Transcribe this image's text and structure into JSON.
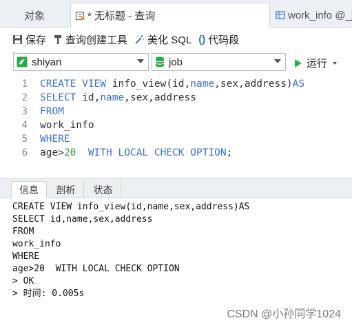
{
  "tabs": {
    "objects": "对象",
    "query": "* 无标题 - 查询",
    "work_info": "work_info @_j"
  },
  "toolbar": {
    "save": "保存",
    "query_builder": "查询创建工具",
    "beautify": "美化 SQL",
    "snippet": "代码段"
  },
  "selectors": {
    "connection": "shiyan",
    "database": "job",
    "run": "运行"
  },
  "editor": {
    "line_numbers": [
      "1",
      "2",
      "3",
      "4",
      "5",
      "6"
    ],
    "l1": {
      "kw1": "CREATE VIEW",
      "mid": " info_view(id,",
      "kw2": "name",
      "rest": ",sex,address)",
      "kw3": "AS"
    },
    "l2": {
      "kw1": "SELECT",
      "mid": " id,",
      "kw2": "name",
      "rest": ",sex,address"
    },
    "l3": {
      "kw1": "FROM"
    },
    "l4": {
      "text": "work_info"
    },
    "l5": {
      "kw1": "WHERE"
    },
    "l6": {
      "pre": "age>",
      "num": "20",
      "kw": "  WITH LOCAL CHECK OPTION",
      "end": ";"
    }
  },
  "result_tabs": [
    "信息",
    "剖析",
    "状态"
  ],
  "output": [
    "CREATE VIEW info_view(id,name,sex,address)AS",
    "SELECT id,name,sex,address",
    "FROM",
    "work_info",
    "WHERE",
    "age>20  WITH LOCAL CHECK OPTION",
    "> OK",
    "> 时间: 0.005s"
  ],
  "watermark": "CSDN @小孙同学1024",
  "colors": {
    "keyword": "#3b6fd4",
    "number": "#2e9a3c",
    "run_icon": "#2db04b",
    "connection_icon": "#2aa84a",
    "database_icon": "#2aa84a"
  }
}
